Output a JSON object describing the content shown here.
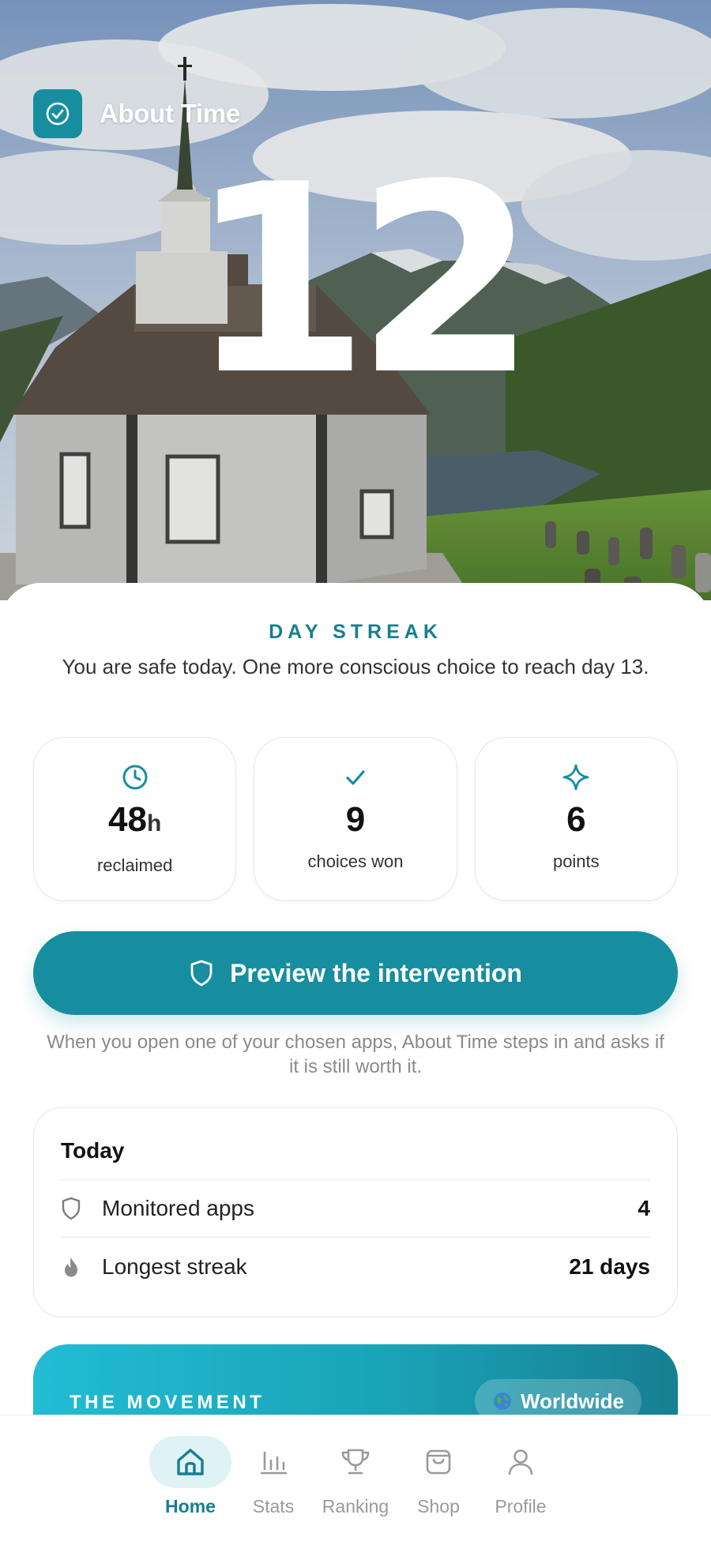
{
  "brand": {
    "name": "About Time"
  },
  "hero": {
    "streak_number": "12"
  },
  "streak": {
    "label": "DAY STREAK",
    "subtitle": "You are safe today. One more conscious choice to reach day 13."
  },
  "stats": [
    {
      "icon": "clock-icon",
      "value": "48",
      "unit": "h",
      "label": "reclaimed"
    },
    {
      "icon": "check-icon",
      "value": "9",
      "unit": "",
      "label": "choices won"
    },
    {
      "icon": "sparkle-icon",
      "value": "6",
      "unit": "",
      "label": "points"
    }
  ],
  "cta": {
    "label": "Preview the intervention",
    "note": "When you open one of your chosen apps, About Time steps in and asks if it is still worth it."
  },
  "today": {
    "title": "Today",
    "rows": [
      {
        "icon": "shield-icon",
        "label": "Monitored apps",
        "value": "4"
      },
      {
        "icon": "flame-icon",
        "label": "Longest streak",
        "value": "21 days"
      }
    ]
  },
  "movement": {
    "label": "THE MOVEMENT",
    "scope": "Worldwide"
  },
  "tabs": [
    {
      "icon": "home-icon",
      "label": "Home",
      "active": true
    },
    {
      "icon": "stats-icon",
      "label": "Stats",
      "active": false
    },
    {
      "icon": "trophy-icon",
      "label": "Ranking",
      "active": false
    },
    {
      "icon": "bag-icon",
      "label": "Shop",
      "active": false
    },
    {
      "icon": "profile-icon",
      "label": "Profile",
      "active": false
    }
  ],
  "colors": {
    "accent": "#168ea0",
    "accent_dark": "#167f91",
    "tab_active_bg": "#dff2f5"
  }
}
